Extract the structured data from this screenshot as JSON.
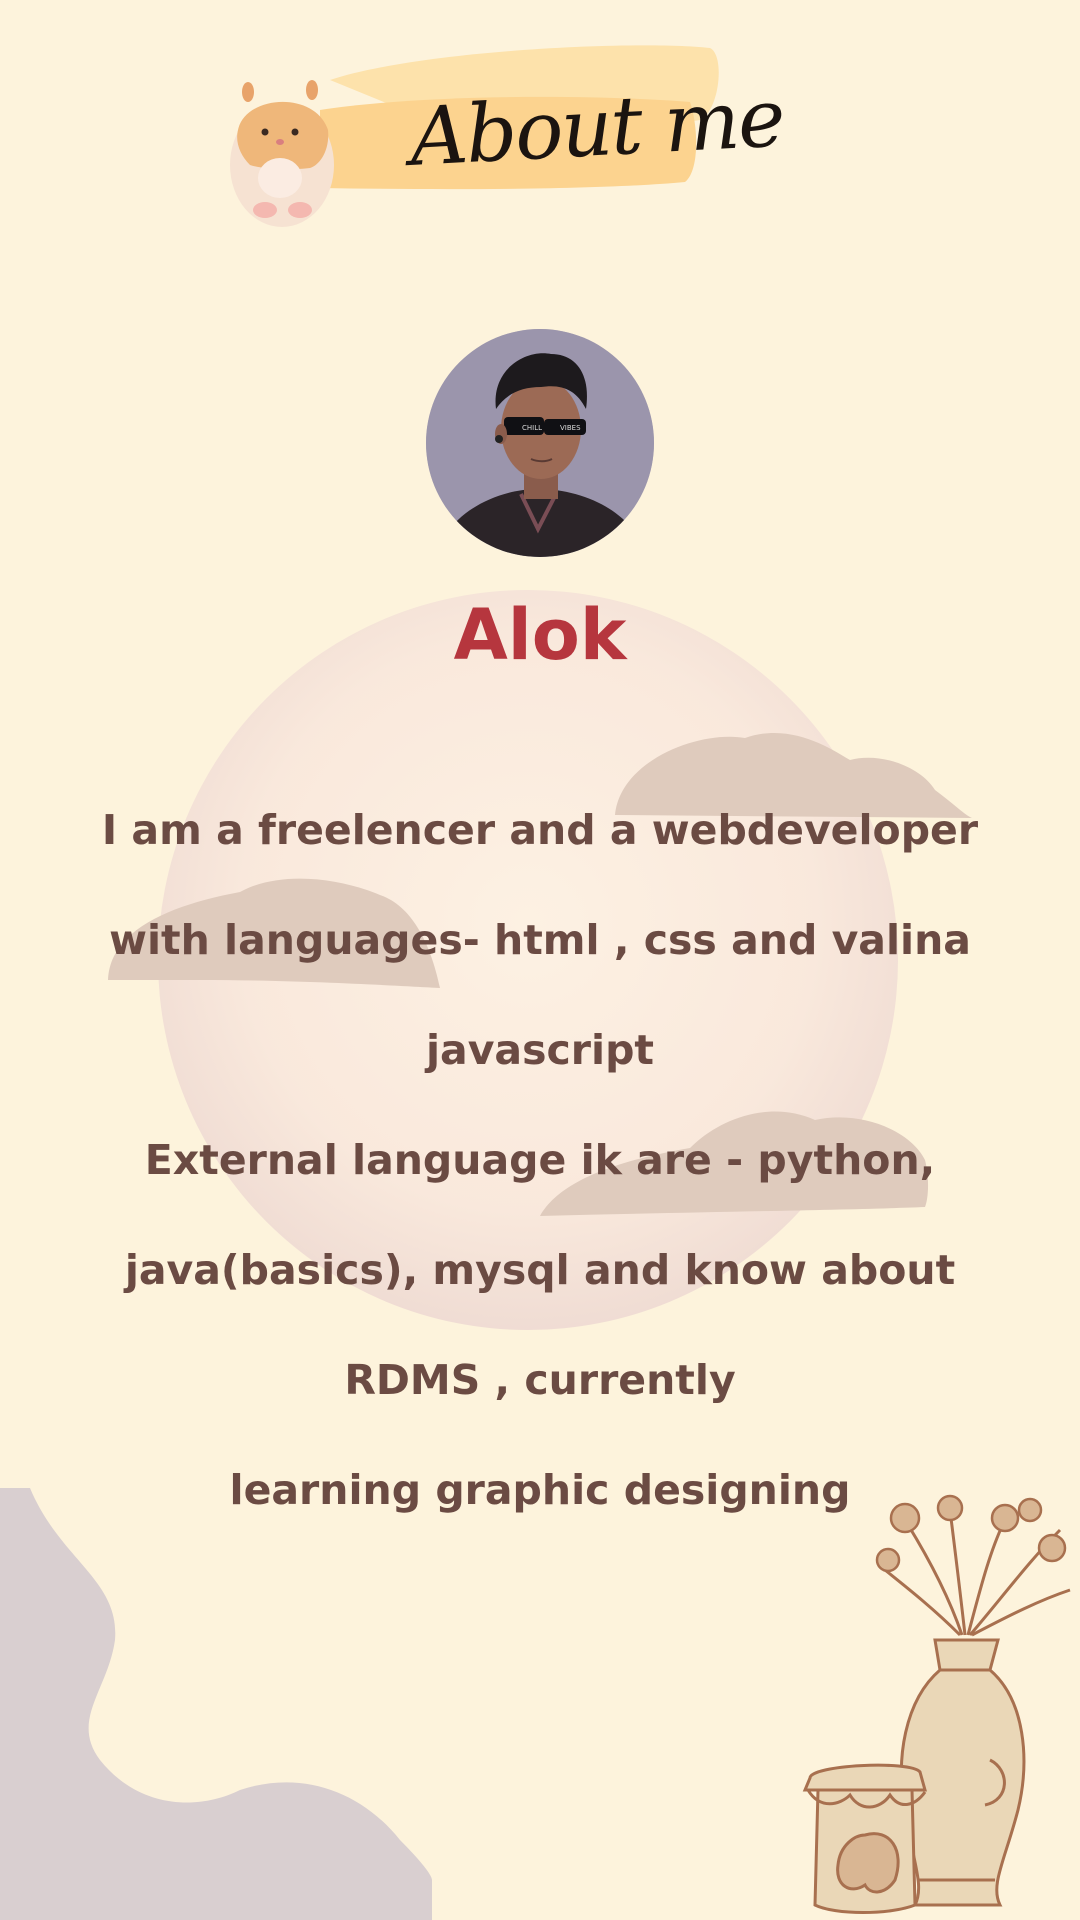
{
  "header": {
    "title": "About me",
    "mascot_icon": "hamster-icon"
  },
  "profile": {
    "avatar_icon": "profile-photo",
    "name": "Alok"
  },
  "bio": {
    "lines": [
      "I am a freelencer and a webdeveloper",
      "with languages- html , css and valina",
      "javascript",
      "External language ik are - python,",
      "java(basics), mysql  and know about",
      "RDMS , currently",
      "learning graphic designing"
    ]
  },
  "decor": {
    "icons": [
      "cloud-icon",
      "wave-blob-icon",
      "flower-vase-icon",
      "strawberry-jar-icon"
    ]
  },
  "colors": {
    "background": "#fdf3dc",
    "name": "#b6363e",
    "text": "#6b4b43",
    "highlight": "#fcd38f",
    "cloud": "#dfcbbd",
    "blob": "#d9cfd0",
    "line_art": "#a8704f"
  }
}
